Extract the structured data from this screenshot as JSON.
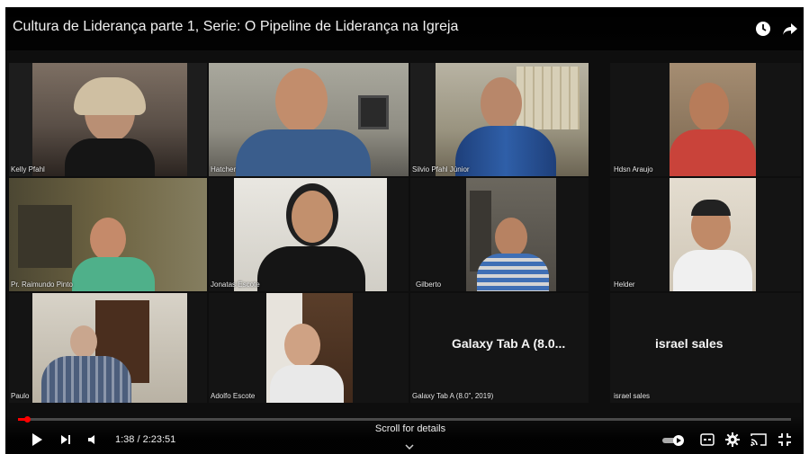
{
  "video": {
    "title": "Cultura de Liderança parte 1, Serie: O Pipeline de Liderança na Igreja",
    "current_time": "1:38",
    "duration": "2:23:51",
    "time_display": "1:38 / 2:23:51",
    "progress_fraction": 0.0114,
    "scroll_hint": "Scroll for details"
  },
  "participants": [
    {
      "name": "Kelly Pfahl"
    },
    {
      "name": "Hatcher"
    },
    {
      "name": "Silvio Pfahl Júnior"
    },
    {
      "name": "Hdsn Araujo"
    },
    {
      "name": "Pr. Raimundo Pinto"
    },
    {
      "name": "Jonatas Escote"
    },
    {
      "name": "Gilberto"
    },
    {
      "name": "Helder"
    },
    {
      "name": "Paulo"
    },
    {
      "name": "Adolfo Escote"
    },
    {
      "name": "Galaxy Tab A (8.0\", 2019)",
      "display_name": "Galaxy Tab A (8.0..."
    },
    {
      "name": "israel sales",
      "display_name": "israel sales"
    }
  ],
  "icons": {
    "top_right": [
      "watch-later-icon",
      "share-icon"
    ],
    "controls_left": [
      "play-icon",
      "next-icon",
      "volume-icon"
    ],
    "controls_right": [
      "autoplay-toggle-icon",
      "captions-icon",
      "settings-icon",
      "cast-icon",
      "exit-fullscreen-icon"
    ]
  },
  "colors": {
    "progress": "#ff0000",
    "background": "#0e0e0e"
  }
}
